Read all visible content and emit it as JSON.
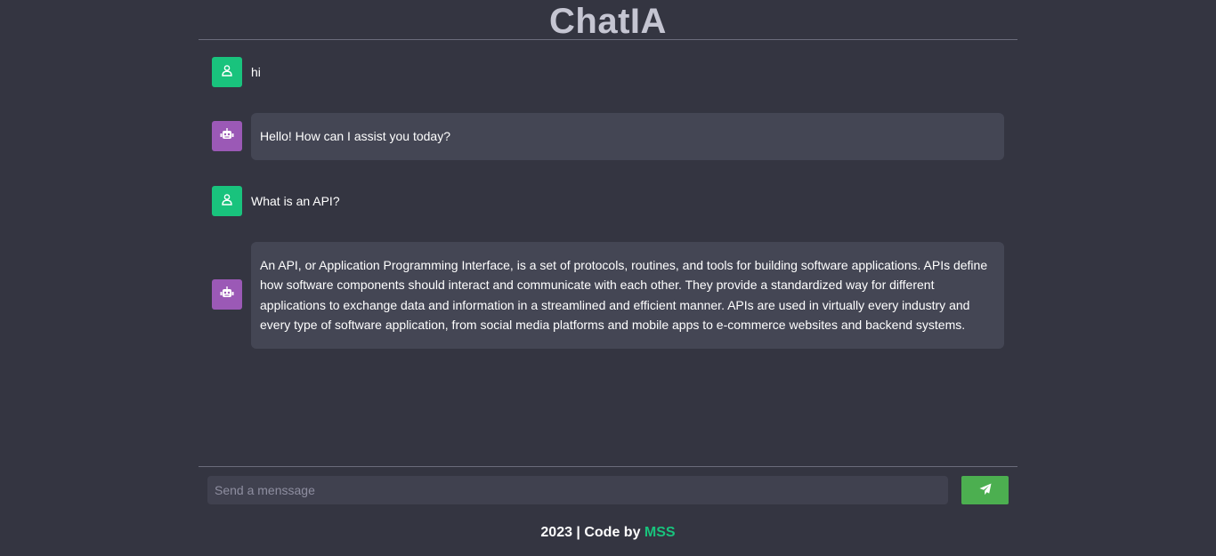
{
  "app": {
    "title": "ChatIA"
  },
  "messages": [
    {
      "role": "user",
      "text": "hi"
    },
    {
      "role": "assistant",
      "text": "Hello! How can I assist you today?"
    },
    {
      "role": "user",
      "text": "What is an API?"
    },
    {
      "role": "assistant",
      "text": "An API, or Application Programming Interface, is a set of protocols, routines, and tools for building software applications. APIs define how software components should interact and communicate with each other. They provide a standardized way for different applications to exchange data and information in a streamlined and efficient manner. APIs are used in virtually every industry and every type of software application, from social media platforms and mobile apps to e-commerce websites and backend systems."
    }
  ],
  "composer": {
    "placeholder": "Send a menssage",
    "value": "",
    "send_icon": "paper-plane-icon"
  },
  "footer": {
    "prefix": "2023 | Code by ",
    "author": "MSS"
  },
  "colors": {
    "user_avatar": "#19c37d",
    "bot_avatar": "#9b59b6",
    "send_button": "#4caf50",
    "background": "#343541",
    "bubble": "#444654"
  },
  "icons": {
    "user": "user-icon",
    "assistant": "robot-icon"
  }
}
